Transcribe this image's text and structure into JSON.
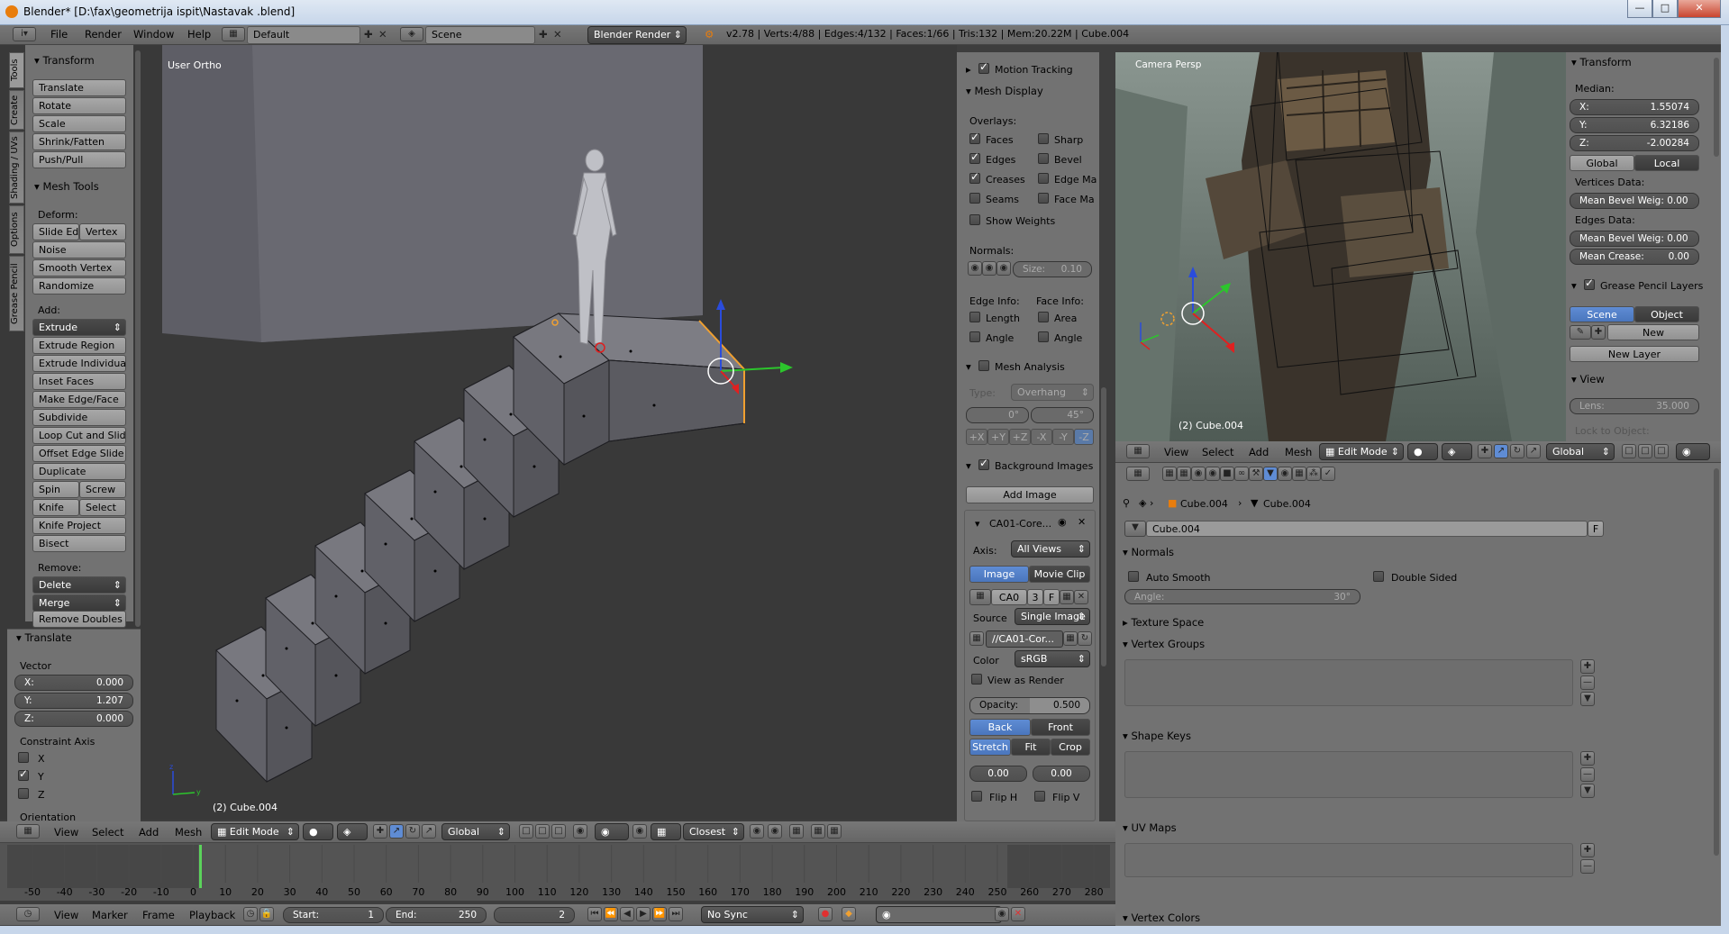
{
  "window": {
    "title": "Blender* [D:\\fax\\geometrija ispit\\Nastavak .blend]"
  },
  "info_header": {
    "menus": [
      "File",
      "Render",
      "Window",
      "Help"
    ],
    "screen": "Default",
    "scene": "Scene",
    "engine": "Blender Render",
    "stats": "v2.78 | Verts:4/88 | Edges:4/132 | Faces:1/66 | Tris:132 | Mem:20.22M | Cube.004"
  },
  "tool_shelf": {
    "tabs": [
      "Tools",
      "Create",
      "Shading / UVs",
      "Options",
      "Grease Pencil"
    ],
    "transform_title": "Transform",
    "transform_buttons": [
      "Translate",
      "Rotate",
      "Scale",
      "Shrink/Fatten",
      "Push/Pull"
    ],
    "mesh_tools_title": "Mesh Tools",
    "deform_label": "Deform:",
    "deform_row": [
      "Slide Ed",
      "Vertex"
    ],
    "deform_buttons": [
      "Noise",
      "Smooth Vertex",
      "Randomize"
    ],
    "add_label": "Add:",
    "extrude": "Extrude",
    "add_buttons": [
      "Extrude Region",
      "Extrude Individual",
      "Inset Faces",
      "Make Edge/Face",
      "Subdivide",
      "Loop Cut and Slide",
      "Offset Edge Slide",
      "Duplicate"
    ],
    "spin_row": [
      "Spin",
      "Screw"
    ],
    "knife_row": [
      "Knife",
      "Select"
    ],
    "more_buttons": [
      "Knife Project",
      "Bisect"
    ],
    "remove_label": "Remove:",
    "delete": "Delete",
    "merge": "Merge",
    "remove_doubles": "Remove Doubles"
  },
  "operator_panel": {
    "title": "Translate",
    "vector_label": "Vector",
    "x": "X:",
    "x_val": "0.000",
    "y": "Y:",
    "y_val": "1.207",
    "z": "Z:",
    "z_val": "0.000",
    "constraint_label": "Constraint Axis",
    "axes": [
      "X",
      "Y",
      "Z"
    ],
    "orientation_label": "Orientation"
  },
  "viewport_left": {
    "view_name": "User Ortho",
    "object_name": "(2) Cube.004",
    "header_menus": [
      "View",
      "Select",
      "Add",
      "Mesh"
    ],
    "mode": "Edit Mode",
    "orientation": "Global",
    "snap": "Closest"
  },
  "properties_n": {
    "motion_tracking": "Motion Tracking",
    "mesh_display": "Mesh Display",
    "overlays": "Overlays:",
    "overlay_left": [
      "Faces",
      "Edges",
      "Creases",
      "Seams"
    ],
    "overlay_right": [
      "Sharp",
      "Bevel",
      "Edge Ma",
      "Face Ma"
    ],
    "show_weights": "Show Weights",
    "normals": "Normals:",
    "size": "Size:",
    "size_val": "0.10",
    "edge_info": "Edge Info:",
    "face_info": "Face Info:",
    "length": "Length",
    "area": "Area",
    "angle1": "Angle",
    "angle2": "Angle",
    "mesh_analysis": "Mesh Analysis",
    "type": "Type:",
    "type_val": "Overhang",
    "deg0": "0°",
    "deg45": "45°",
    "axes": [
      "+X",
      "+Y",
      "+Z",
      "-X",
      "-Y",
      "-Z"
    ],
    "background_images": "Background Images",
    "add_image": "Add Image",
    "image_name": "CA01-Core...",
    "axis": "Axis:",
    "axis_val": "All Views",
    "image_tab": "Image",
    "movie_tab": "Movie Clip",
    "ca0": "CA0",
    "three": "3",
    "f": "F",
    "source": "Source",
    "source_val": "Single Image",
    "file": "//CA01-Cor...",
    "color": "Color",
    "color_val": "sRGB",
    "view_as_render": "View as Render",
    "opacity": "Opacity:",
    "opacity_val": "0.500",
    "back": "Back",
    "front": "Front",
    "stretch": "Stretch",
    "fit": "Fit",
    "crop": "Crop",
    "offx": "0.00",
    "offy": "0.00",
    "flip_h": "Flip H",
    "flip_v": "Flip V"
  },
  "viewport_right": {
    "view_name": "Camera Persp",
    "object_name": "(2) Cube.004",
    "header_menus": [
      "View",
      "Select",
      "Add",
      "Mesh"
    ],
    "mode": "Edit Mode",
    "orientation": "Global"
  },
  "right_n_panel": {
    "transform": "Transform",
    "median": "Median:",
    "x": "X:",
    "x_val": "1.55074",
    "y": "Y:",
    "y_val": "6.32186",
    "z": "Z:",
    "z_val": "-2.00284",
    "global": "Global",
    "local": "Local",
    "vertices_data": "Vertices Data:",
    "mean_bevel_v": "Mean Bevel Weig: 0.00",
    "edges_data": "Edges Data:",
    "mean_bevel_e": "Mean Bevel Weig: 0.00",
    "mean_crease": "Mean Crease:",
    "mean_crease_val": "0.00",
    "grease": "Grease Pencil Layers",
    "scene": "Scene",
    "object": "Object",
    "new": "New",
    "new_layer": "New Layer",
    "view": "View",
    "lens": "Lens:",
    "lens_val": "35.000",
    "lock": "Lock to Object:"
  },
  "properties_editor": {
    "crumb_obj": "Cube.004",
    "crumb_mesh": "Cube.004",
    "datablock": "Cube.004",
    "f": "F",
    "normals": "Normals",
    "auto_smooth": "Auto Smooth",
    "double_sided": "Double Sided",
    "angle": "Angle:",
    "angle_val": "30°",
    "texture_space": "Texture Space",
    "vertex_groups": "Vertex Groups",
    "shape_keys": "Shape Keys",
    "uv_maps": "UV Maps",
    "vertex_colors": "Vertex Colors"
  },
  "timeline": {
    "ticks": [
      "-50",
      "-40",
      "-30",
      "-20",
      "-10",
      "0",
      "10",
      "20",
      "30",
      "40",
      "50",
      "60",
      "70",
      "80",
      "90",
      "100",
      "110",
      "120",
      "130",
      "140",
      "150",
      "160",
      "170",
      "180",
      "190",
      "200",
      "210",
      "220",
      "230",
      "240",
      "250",
      "260",
      "270",
      "280"
    ],
    "menus": [
      "View",
      "Marker",
      "Frame",
      "Playback"
    ],
    "start": "Start:",
    "start_val": "1",
    "end": "End:",
    "end_val": "250",
    "current": "2",
    "sync": "No Sync"
  }
}
